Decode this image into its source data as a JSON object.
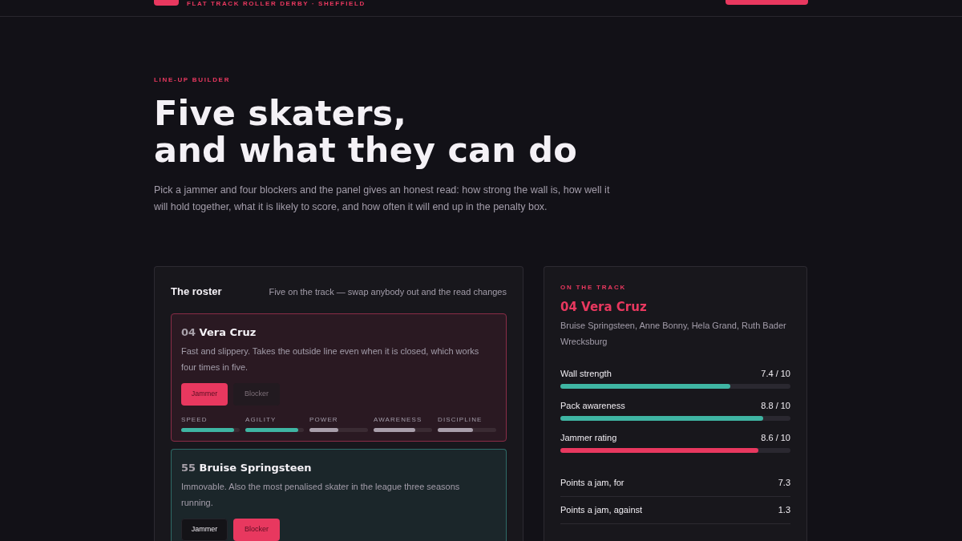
{
  "header": {
    "tagline": "FLAT TRACK ROLLER DERBY · SHEFFIELD"
  },
  "hero": {
    "eyebrow": "LINE-UP BUILDER",
    "title_lines": [
      "Five skaters,",
      "and what they can do"
    ],
    "intro": "Pick a jammer and four blockers and the panel gives an honest read: how strong the wall is, how well it will hold together, what it is likely to score, and how often it will end up in the penalty box."
  },
  "roster": {
    "title": "The roster",
    "note": "Five on the track — swap anybody out and the read changes",
    "skaters": [
      {
        "number": "04",
        "name": "Vera Cruz",
        "description": "Fast and slippery. Takes the outside line even when it is closed, which works four times in five.",
        "roles": [
          {
            "kind": "jammer",
            "label": "Jammer",
            "selected": true
          },
          {
            "kind": "blocker",
            "label": "Blocker",
            "selected": false
          }
        ],
        "stats": [
          {
            "label": "SPEED",
            "level": 0.91
          },
          {
            "label": "AGILITY",
            "level": 0.91
          },
          {
            "label": "POWER",
            "level": 0.49
          },
          {
            "label": "AWARENESS",
            "level": 0.71
          },
          {
            "label": "DISCIPLINE",
            "level": 0.6
          }
        ]
      },
      {
        "number": "55",
        "name": "Bruise Springsteen",
        "description": "Immovable. Also the most penalised skater in the league three seasons running.",
        "roles": [
          {
            "kind": "jammer",
            "label": "Jammer",
            "selected": false
          },
          {
            "kind": "blocker",
            "label": "Blocker",
            "selected": true
          }
        ]
      }
    ]
  },
  "track": {
    "eyebrow": "ON THE TRACK",
    "jammer": "04 Vera Cruz",
    "blockers": "Bruise Springsteen, Anne Bonny, Hela Grand, Ruth Bader Wrecksburg",
    "meters": [
      {
        "label": "Wall strength",
        "reading": "7.4 / 10",
        "level": 0.74,
        "color": "#3fb5a3"
      },
      {
        "label": "Pack awareness",
        "reading": "8.8 / 10",
        "level": 0.88,
        "color": "#3fb5a3"
      },
      {
        "label": "Jammer rating",
        "reading": "8.6 / 10",
        "level": 0.86,
        "color": "#e8385f"
      }
    ],
    "figures": [
      {
        "label": "Points a jam, for",
        "value": "7.3"
      },
      {
        "label": "Points a jam, against",
        "value": "1.3"
      }
    ]
  }
}
